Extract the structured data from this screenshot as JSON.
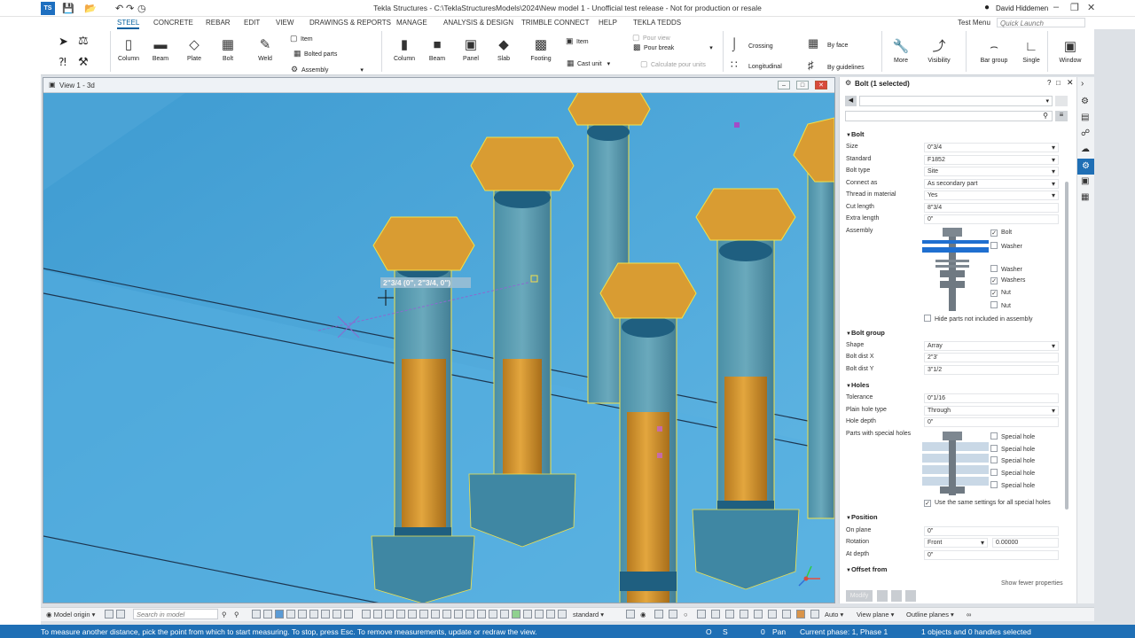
{
  "title": "Tekla Structures - C:\\TeklaStructuresModels\\2024\\New model 1 - Unofficial test release - Not for production or resale",
  "logo_text": "TS",
  "user": "David Hiddemen",
  "menu": {
    "items": [
      "STEEL",
      "CONCRETE",
      "REBAR",
      "EDIT",
      "VIEW",
      "DRAWINGS & REPORTS",
      "MANAGE",
      "ANALYSIS & DESIGN",
      "TRIMBLE CONNECT",
      "HELP",
      "TEKLA TEDDS"
    ],
    "test_menu": "Test Menu",
    "quick_launch": "Quick Launch"
  },
  "ribbon": {
    "steel": {
      "column": "Column",
      "beam": "Beam",
      "plate": "Plate",
      "bolt": "Bolt",
      "weld": "Weld",
      "item": "Item",
      "bolted_parts": "Bolted parts",
      "assembly": "Assembly"
    },
    "concrete": {
      "column": "Column",
      "beam": "Beam",
      "panel": "Panel",
      "slab": "Slab",
      "footing": "Footing",
      "item": "Item",
      "cast_unit": "Cast unit",
      "pour_view": "Pour view",
      "pour_break": "Pour break",
      "calculate_pour_units": "Calculate pour units"
    },
    "rebar": {
      "crossing": "Crossing",
      "by_face": "By face",
      "longitudinal": "Longitudinal",
      "by_guidelines": "By guidelines",
      "more": "More",
      "visibility": "Visibility",
      "bar_group": "Bar group",
      "single": "Single",
      "window": "Window"
    }
  },
  "view": {
    "title": "View 1 - 3d",
    "measurement": "2\"3/4 (0\", 2\"3/4, 0\")"
  },
  "props": {
    "header": "Bolt (1 selected)",
    "bolt_section": "Bolt",
    "fields": [
      {
        "label": "Size",
        "value": "0\"3/4"
      },
      {
        "label": "Standard",
        "value": "F1852"
      },
      {
        "label": "Bolt type",
        "value": "Site"
      },
      {
        "label": "Connect as",
        "value": "As secondary part"
      },
      {
        "label": "Thread in material",
        "value": "Yes"
      },
      {
        "label": "Cut length",
        "value": "8\"3/4"
      },
      {
        "label": "Extra length",
        "value": "0\""
      }
    ],
    "assembly_label": "Assembly",
    "assembly_checks": [
      {
        "label": "Bolt",
        "checked": true
      },
      {
        "label": "Washer",
        "checked": false
      },
      {
        "label": "Washer",
        "checked": false
      },
      {
        "label": "Washers",
        "checked": true
      },
      {
        "label": "Nut",
        "checked": true
      },
      {
        "label": "Nut",
        "checked": false
      }
    ],
    "hide_parts": "Hide parts not included in assembly",
    "bolt_group_section": "Bolt group",
    "group_fields": [
      {
        "label": "Shape",
        "value": "Array"
      },
      {
        "label": "Bolt dist X",
        "value": "2\"3'"
      },
      {
        "label": "Bolt dist Y",
        "value": "3\"1/2"
      }
    ],
    "holes_section": "Holes",
    "hole_fields": [
      {
        "label": "Tolerance",
        "value": "0\"1/16"
      },
      {
        "label": "Plain hole type",
        "value": "Through"
      },
      {
        "label": "Hole depth",
        "value": "0\""
      }
    ],
    "special_holes_label": "Parts with special holes",
    "special_hole": "Special hole",
    "same_settings": "Use the same settings for all special holes",
    "position_section": "Position",
    "on_plane_label": "On plane",
    "on_plane": "0\"",
    "rotation_label": "Rotation",
    "rotation": "Front",
    "rotation_value": "0.00000",
    "at_depth_label": "At depth",
    "at_depth": "0\"",
    "offset_section": "Offset from",
    "modify": "Modify",
    "show_fewer": "Show fewer properties"
  },
  "bottom": {
    "model_origin": "Model origin",
    "search_placeholder": "Search in model",
    "standard": "standard",
    "auto": "Auto",
    "view_plane": "View plane",
    "outline_planes": "Outline planes"
  },
  "status": {
    "message": "To measure another distance, pick the point from which to start measuring. To stop, press Esc. To remove measurements, update or redraw the view.",
    "o": "O",
    "s": "S",
    "zero": "0",
    "pan": "Pan",
    "phase": "Current phase: 1, Phase 1",
    "selection": "1 objects and 0 handles selected"
  },
  "colors": {
    "accent": "#1f6fb5",
    "bolt_gold": "#d99c32",
    "bolt_outline": "#f3e24a",
    "steel_blue": "#5bb1df"
  }
}
